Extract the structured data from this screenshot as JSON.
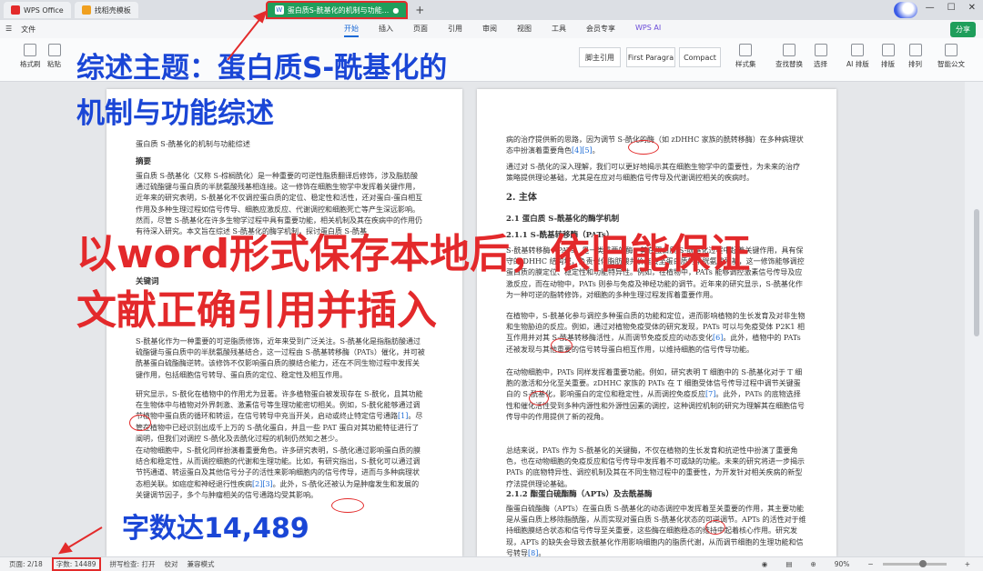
{
  "tabs": {
    "app": "WPS Office",
    "template": "找稻壳模板",
    "document": "蛋白质S-酰基化的机制与功能..."
  },
  "menubar": {
    "file": "文件",
    "items": [
      "开始",
      "插入",
      "页面",
      "引用",
      "审阅",
      "视图",
      "工具",
      "会员专享",
      "WPS AI"
    ],
    "share": "分享"
  },
  "ribbon": {
    "format_painter": "格式刷",
    "paste": "粘贴",
    "style_normal": "脚主引用",
    "style_first": "First Paragra",
    "style_compact": "Compact",
    "styles_set": "样式集",
    "find_replace": "查找替换",
    "select": "选择",
    "ai_layout": "AI 排版",
    "layout": "排版",
    "arrange": "排列",
    "smart_doc": "智能公文"
  },
  "page1": {
    "title": "蛋白质 S-酰基化的机制与功能综述",
    "abstract_h": "摘要",
    "abstract": "蛋白质 S-酰基化（又称 S-棕榈酰化）是一种重要的可逆性脂质翻译后修饰，涉及脂肪酸通过硫酯键与蛋白质的半胱氨酸残基相连接。这一修饰在细胞生物学中发挥着关键作用，近年来的研究表明，S-酰基化不仅调控蛋白质的定位、稳定性和活性，还对蛋白-蛋白相互作用及多种生理过程如信号传导、细胞应激反应、代谢调控和细胞死亡等产生深远影响。然而，尽管 S-酰基化在许多生物学过程中具有重要功能，相关机制及其在疾病中的作用仍有待深入研究。本文旨在综述 S-酰基化的酶学机制，探讨蛋白质 S-酰基",
    "keywords_h": "关键词",
    "intro": "S-酰基化作为一种重要的可逆脂质修饰，近年来受到广泛关注。S-酰基化是指脂肪酸通过硫酯键与蛋白质中的半胱氨酸残基结合，这一过程由 S-酰基转移酶（PATs）催化，并可被酰基蛋白硫酯酶逆转。该修饰不仅影响蛋白质的膜结合能力，还在不同生物过程中发挥关键作用，包括细胞信号转导、蛋白质的定位、稳定性及相互作用。",
    "para2": "研究显示，S-酰化在植物中的作用尤为显著。许多植物蛋白被发现存在 S-酰化，且其功能在生物体中与植物对外界刺激、激素信号等生理功能密切相关。例如，S-酰化能够通过调节植物中蛋白质的循环和转运，在信号转导中充当开关，启动或终止特定信号通路",
    "cite1": "[1]",
    "para2b": "。尽管在植物中已经识别出成千上万的 S-酰化蛋白，并且一些 PAT 蛋白对其功能特征进行了阐明，但我们对调控 S-酰化及去酰化过程的机制仍然知之甚少。",
    "para3": "在动物细胞中，S-酰化同样扮演着重要角色。许多研究表明，S-酰化通过影响蛋白质的膜结合和稳定性，从而调控细胞的代谢和生理功能。比如，有研究指出，S-酰化可以通过调节钙通道、转运蛋白及其他信号分子的活性来影响细胞内的信号传导，进而与多种病理状态相关联。如癌症和神经退行性疾病",
    "cite2": "[2][3]",
    "para3b": "。此外，S-酰化还被认为是肿瘤发生和发展的关键调节因子，多个与肿瘤相关的信号通路均受其影响。"
  },
  "page2": {
    "p0": "病的治疗提供新的思路，因为调节 S-酰化的酶（如 zDHHC 家族的酰转移酶）在多种病理状态中扮演着重要角色",
    "cite45": "[4][5]",
    "p0b": "。",
    "p1": "通过对 S-酰化的深入理解，我们可以更好地揭示其在细胞生物学中的重要性，为未来的治疗策略提供理论基础，尤其是在应对与细胞信号传导及代谢调控相关的疾病时。",
    "h_main": "2. 主体",
    "h21": "2.1 蛋白质 S-酰基化的酶学机制",
    "h211": "2.1.1 S-酰基转移酶（PATs）",
    "p2": "S-酰基转移酶（PATs）是一类重要的酶，其在蛋白质 S-酰基化过程中起着关键作用，具有保守的 DHHC 结构域，负责催化脂肪酸共价连接至蛋白质的半胱氨酸残基，这一修饰能够调控蛋白质的膜定位、稳定性和功能特异性。例如，在植物中，PATs 能够调控激素信号传导及应激反应，而在动物中，PATs 则参与免疫及神经功能的调节。近年来的研究显示，S-酰基化作为一种可逆的脂转修饰，对细胞的多种生理过程发挥着重要作用。",
    "p3": "在植物中，S-酰基化参与调控多种蛋白质的功能和定位，进而影响植物的生长发育及对非生物和生物胁迫的反应。例如，通过对植物免疫受体的研究发现，PATs 可以与免疫受体 P2K1 相互作用并对其 S-酰基转移酶活性，从而调节免疫反应的动态变化",
    "cite6": "[6]",
    "p3b": "。此外，植物中的 PATs 还被发现与其他重要的信号转导蛋白相互作用，以维持细胞的信号传导功能。",
    "p4": "在动物细胞中，PATs 同样发挥着重要功能。例如，研究表明 T 细胞中的 S-酰基化对于 T 细胞的激活和分化至关重要。zDHHC 家族的 PATs 在 T 细胞受体信号传导过程中调节关键蛋白的 S-酰基化，影响蛋白的定位和稳定性，从而调控免疫反应",
    "cite7": "[7]",
    "p4b": "。此外，PATs 的底物选择性和催化活性受到多种内源性和外源性因素的调控，这种调控机制的研究为理解其在细胞信号传导中的作用提供了新的视角。",
    "p5": "总结来说，PATs 作为 S-酰基化的关键酶，不仅在植物的生长发育和抗逆性中扮演了重要角色，也在动物细胞的免疫反应和信号传导中发挥着不可或缺的功能。未来的研究将进一步揭示 PATs 的底物特异性、调控机制及其在不同生物过程中的重要性，为开发针对相关疾病的新型疗法提供理论基础。",
    "h212": "2.1.2 酯蛋白硫酯酶（APTs）及去酰基酶",
    "p6": "酯蛋白硫酯酶（APTs）在蛋白质 S-酰基化的动态调控中发挥着至关重要的作用，其主要功能是从蛋白质上移除脂酰酯，从而实现对蛋白质 S-酰基化状态的可逆调节。APTs 的活性对于维持细胞膜结合状态和信号传导至关重要，这些酶在细胞稳态的维持中起着核心作用。研究发现，APTs 的缺失会导致去酰基化作用影响细胞内的脂质代谢，从而调节细胞的生理功能和信号转导",
    "cite8": "[8]",
    "p6b": "。"
  },
  "overlays": {
    "topic_line1": "综述主题：蛋白质S-酰基化的",
    "topic_line2": "机制与功能综述",
    "claim_line1": "以word形式保存本地后，依旧能保证",
    "claim_line2": "文献正确引用并插入",
    "word_count": "字数达14,489"
  },
  "status": {
    "page": "页面: 2/18",
    "words": "字数: 14489",
    "spell": "拼写检查: 打开",
    "proof": "校对",
    "compat": "兼容模式",
    "zoom": "90%"
  }
}
